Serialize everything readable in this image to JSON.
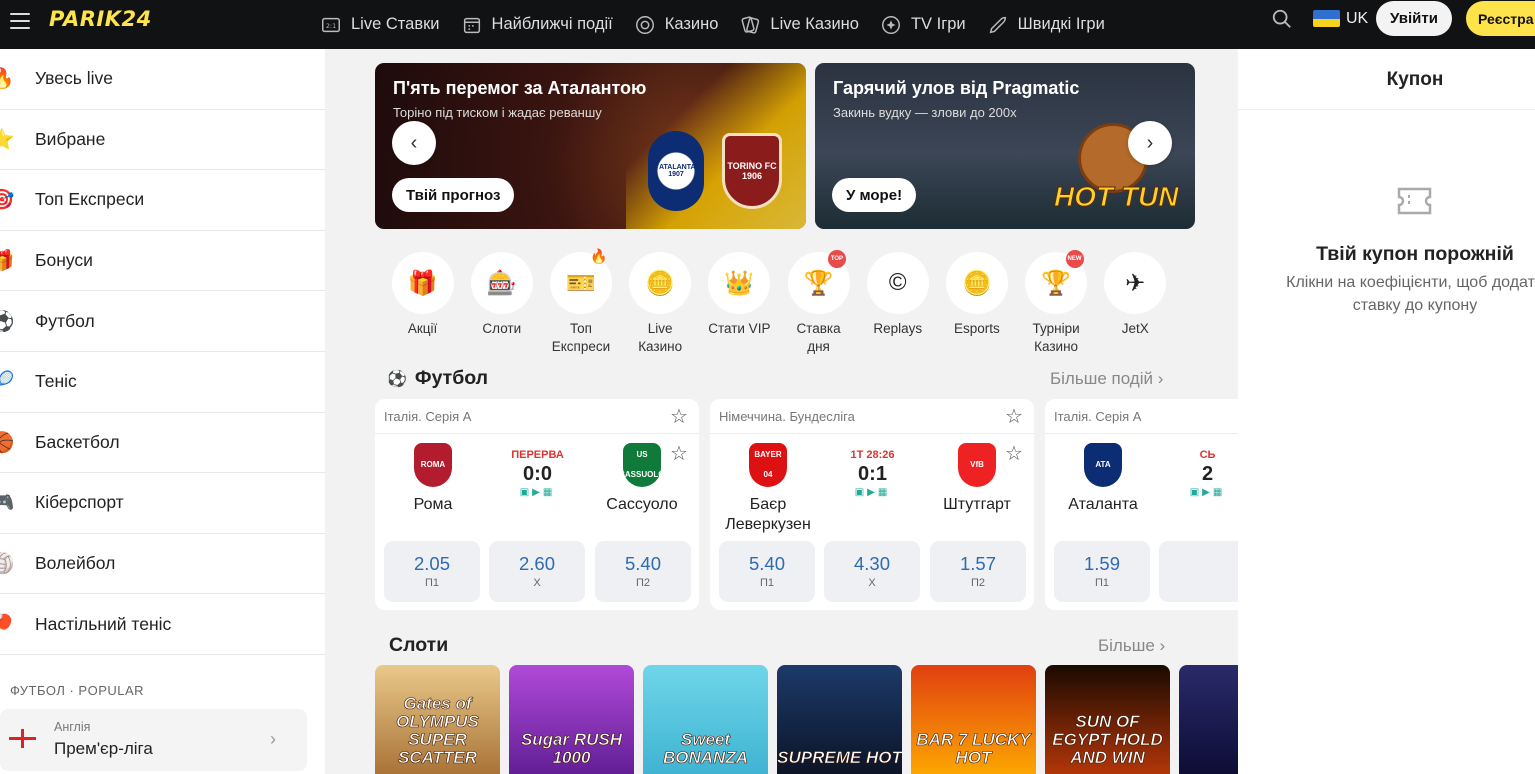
{
  "header": {
    "logo": "PARIK24",
    "nav": [
      {
        "label": "Live Ставки",
        "icon": "live-bets-icon"
      },
      {
        "label": "Найближчі події",
        "icon": "calendar-icon"
      },
      {
        "label": "Казино",
        "icon": "casino-chip-icon"
      },
      {
        "label": "Live Казино",
        "icon": "cards-icon"
      },
      {
        "label": "TV Ігри",
        "icon": "tv-games-icon"
      },
      {
        "label": "Швидкі Ігри",
        "icon": "rocket-icon"
      }
    ],
    "language": "UK",
    "login_label": "Увійти",
    "register_label": "Реєстра"
  },
  "sidebar": {
    "items": [
      {
        "label": "Увесь live",
        "icon": "fire-icon",
        "glyph": "🔥"
      },
      {
        "label": "Вибране",
        "icon": "star-icon",
        "glyph": "⭐"
      },
      {
        "label": "Топ Експреси",
        "icon": "target-icon",
        "glyph": "🎯"
      },
      {
        "label": "Бонуси",
        "icon": "gift-icon",
        "glyph": "🎁"
      },
      {
        "label": "Футбол",
        "icon": "soccer-ball-icon",
        "glyph": "⚽"
      },
      {
        "label": "Теніс",
        "icon": "tennis-ball-icon",
        "glyph": "🎾"
      },
      {
        "label": "Баскетбол",
        "icon": "basketball-icon",
        "glyph": "🏀"
      },
      {
        "label": "Кіберспорт",
        "icon": "gamepad-icon",
        "glyph": "🎮"
      },
      {
        "label": "Волейбол",
        "icon": "volleyball-icon",
        "glyph": "🏐"
      },
      {
        "label": "Настільний теніс",
        "icon": "table-tennis-icon",
        "glyph": "🏓"
      }
    ],
    "section_title": "ФУТБОЛ · POPULAR",
    "league": {
      "country": "Англія",
      "name": "Прем'єр-ліга"
    }
  },
  "banners": [
    {
      "title": "П'ять перемог за Аталантою",
      "subtitle": "Торіно під тиском і жадає реваншу",
      "button": "Твій прогноз",
      "crest1": "ATALANTA 1907",
      "crest2": "TORINO FC 1906"
    },
    {
      "title": "Гарячий улов від Pragmatic",
      "subtitle": "Закинь вудку — злови до 200x",
      "button": "У море!",
      "art_text": "HOT TUN"
    }
  ],
  "categories": [
    {
      "label": "Акції",
      "glyph": "🎁",
      "badge": ""
    },
    {
      "label": "Слоти",
      "glyph": "🎰",
      "badge": ""
    },
    {
      "label": "Топ\nЕкспреси",
      "glyph": "🎫",
      "badge": "fire"
    },
    {
      "label": "Live\nКазино",
      "glyph": "🪙",
      "badge": ""
    },
    {
      "label": "Стати VIP",
      "glyph": "👑",
      "badge": ""
    },
    {
      "label": "Ставка\nдня",
      "glyph": "🏆",
      "badge": "TOP"
    },
    {
      "label": "Replays",
      "glyph": "©",
      "badge": ""
    },
    {
      "label": "Esports",
      "glyph": "🪙",
      "badge": ""
    },
    {
      "label": "Турніри\nКазино",
      "glyph": "🏆",
      "badge": "NEW"
    },
    {
      "label": "JetX",
      "glyph": "✈",
      "badge": ""
    }
  ],
  "football": {
    "title": "Футбол",
    "more": "Більше подій",
    "matches": [
      {
        "league": "Італія. Серія А",
        "team1": "Рома",
        "team2": "Сассуоло",
        "status": "ПЕРЕРВА",
        "score": "0:0",
        "odds": [
          {
            "v": "2.05",
            "k": "П1"
          },
          {
            "v": "2.60",
            "k": "Х"
          },
          {
            "v": "5.40",
            "k": "П2"
          }
        ],
        "c1": "#b31b2e",
        "c2": "#0f7a3a",
        "l1": "ROMA",
        "l2": "US SASSUOLO"
      },
      {
        "league": "Німеччина. Бундесліга",
        "team1": "Баєр Леверкузен",
        "team2": "Штутгарт",
        "status": "1Т 28:26",
        "score": "0:1",
        "odds": [
          {
            "v": "5.40",
            "k": "П1"
          },
          {
            "v": "4.30",
            "k": "Х"
          },
          {
            "v": "1.57",
            "k": "П2"
          }
        ],
        "c1": "#d11",
        "c2": "#e22",
        "l1": "BAYER 04",
        "l2": "VfB"
      },
      {
        "league": "Італія. Серія А",
        "team1": "Аталанта",
        "team2": "",
        "status": "СЬ",
        "score": "2",
        "odds": [
          {
            "v": "1.59",
            "k": "П1"
          },
          {
            "v": "",
            "k": ""
          },
          {
            "v": "",
            "k": ""
          }
        ],
        "c1": "#0c2c73",
        "c2": "#fff",
        "l1": "ATA",
        "l2": ""
      }
    ]
  },
  "slots_section": {
    "title": "Слоти",
    "more": "Більше",
    "items": [
      {
        "name": "Gates of OLYMPUS SUPER SCATTER",
        "bg": "linear-gradient(180deg,#e8c98a,#a46a2e)"
      },
      {
        "name": "Sugar RUSH 1000",
        "bg": "linear-gradient(180deg,#b04ad8,#5b1a8f)"
      },
      {
        "name": "Sweet BONANZA",
        "bg": "linear-gradient(180deg,#6fd6e8,#3ab0d0)"
      },
      {
        "name": "SUPREME HOT",
        "bg": "linear-gradient(180deg,#1c3a6a,#0b1020)"
      },
      {
        "name": "BAR 7 LUCKY HOT",
        "bg": "linear-gradient(180deg,#e04010,#ffb000)"
      },
      {
        "name": "SUN OF EGYPT HOLD AND WIN",
        "bg": "linear-gradient(180deg,#1a0a00,#c23a0a)"
      },
      {
        "name": "",
        "bg": "linear-gradient(180deg,#2a2a6a,#0a0a30)"
      }
    ]
  },
  "coupon": {
    "title": "Купон",
    "empty_title": "Твій купон порожній",
    "hint": "Клікни на коефіцієнти, щоб додати ставку до купону"
  },
  "colors": {
    "brand_yellow": "#ffe34a",
    "header_bg": "#111214",
    "odds_blue": "#2f6bb0",
    "live_red": "#d33"
  }
}
